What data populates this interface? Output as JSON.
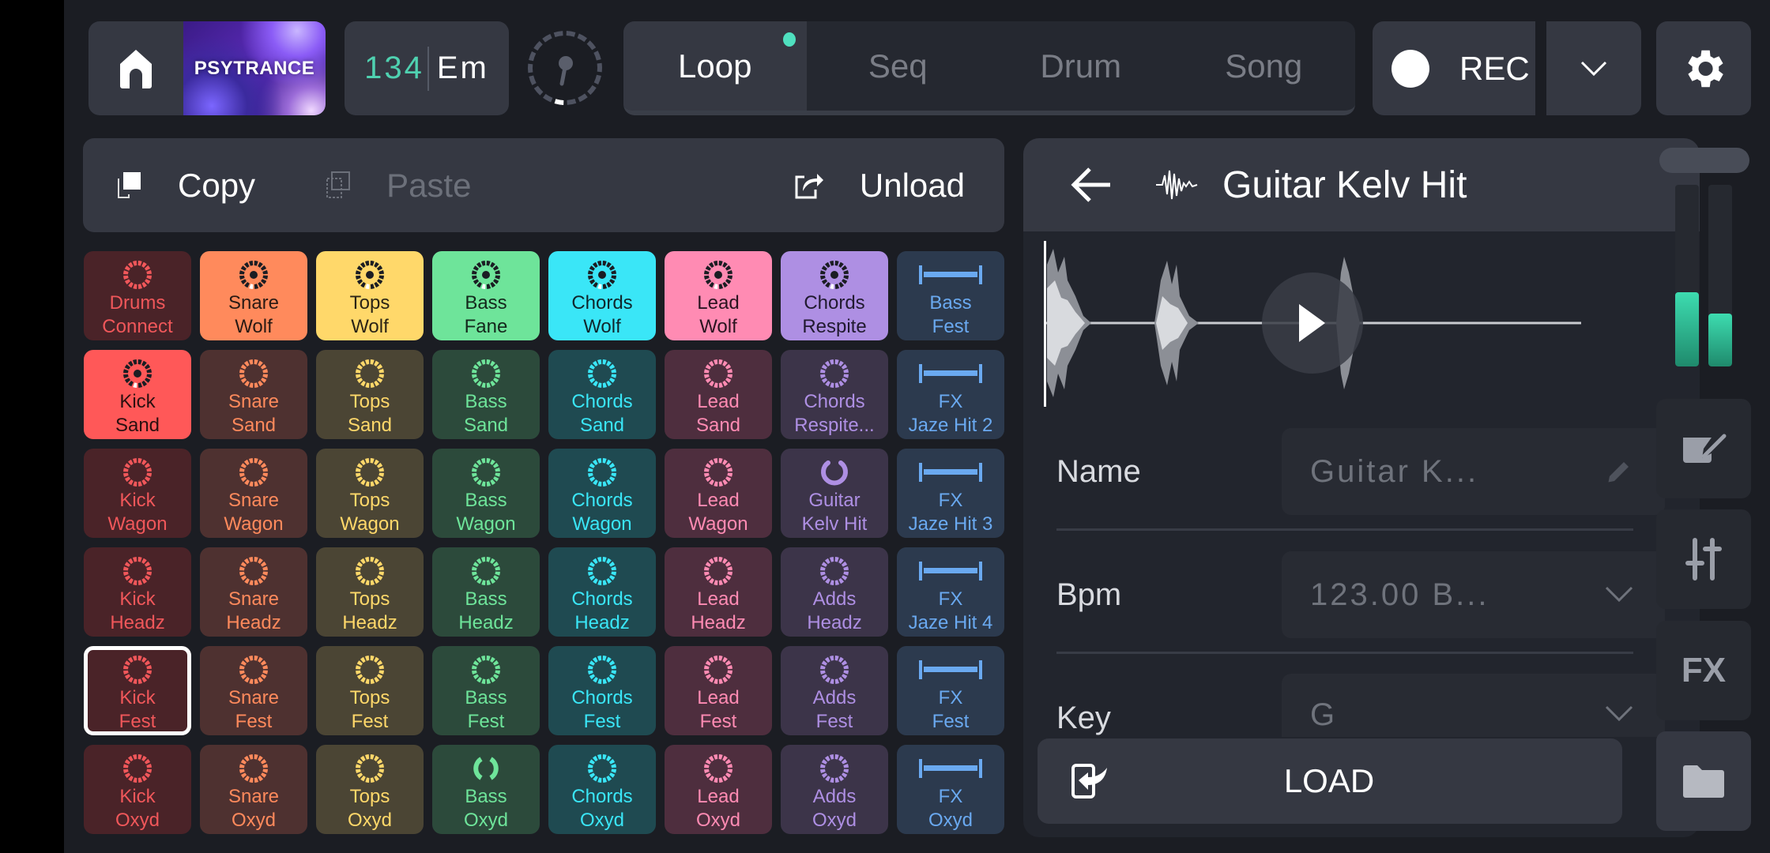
{
  "topbar": {
    "project_cover_label": "PSYTRANCE",
    "tempo": "134",
    "key": "Em",
    "tabs": [
      {
        "label": "Loop",
        "active": true,
        "indicator": true
      },
      {
        "label": "Seq",
        "active": false
      },
      {
        "label": "Drum",
        "active": false
      },
      {
        "label": "Song",
        "active": false
      }
    ],
    "rec_label": "REC",
    "icons": {
      "home": "home-icon",
      "metronome": "dial-icon",
      "dropdown": "chevron-down-icon",
      "settings": "gear-icon"
    }
  },
  "toolbar": {
    "copy_label": "Copy",
    "paste_label": "Paste",
    "unload_label": "Unload"
  },
  "pads": [
    [
      {
        "l1": "Drums",
        "l2": "Connect",
        "bg": "#4a2328",
        "fg": "#f0575a",
        "icon": "ring"
      },
      {
        "l1": "Snare",
        "l2": "Wolf",
        "bg": "#ff8a5c",
        "fg": "#2a1a14",
        "icon": "playing"
      },
      {
        "l1": "Tops",
        "l2": "Wolf",
        "bg": "#ffd86a",
        "fg": "#2a2416",
        "icon": "playing"
      },
      {
        "l1": "Bass",
        "l2": "Fane",
        "bg": "#6ee49a",
        "fg": "#14281c",
        "icon": "playing"
      },
      {
        "l1": "Chords",
        "l2": "Wolf",
        "bg": "#3ae6f7",
        "fg": "#10262c",
        "icon": "playing"
      },
      {
        "l1": "Lead",
        "l2": "Wolf",
        "bg": "#ff8bb3",
        "fg": "#2a1420",
        "icon": "playing"
      },
      {
        "l1": "Chords",
        "l2": "Respite",
        "bg": "#ae8fe3",
        "fg": "#211a30",
        "icon": "playing"
      },
      {
        "l1": "Bass",
        "l2": "Fest",
        "bg": "#2c3a4e",
        "fg": "#6aa9f0",
        "icon": "oneshot"
      }
    ],
    [
      {
        "l1": "Kick",
        "l2": "Sand",
        "bg": "#ff5858",
        "fg": "#2a1010",
        "icon": "playing"
      },
      {
        "l1": "Snare",
        "l2": "Sand",
        "bg": "#4e3130",
        "fg": "#ff8a5c",
        "icon": "ring"
      },
      {
        "l1": "Tops",
        "l2": "Sand",
        "bg": "#4b4534",
        "fg": "#ffd86a",
        "icon": "ring"
      },
      {
        "l1": "Bass",
        "l2": "Sand",
        "bg": "#2c4a3b",
        "fg": "#6ee49a",
        "icon": "ring"
      },
      {
        "l1": "Chords",
        "l2": "Sand",
        "bg": "#1f4a51",
        "fg": "#3ae6f7",
        "icon": "ring"
      },
      {
        "l1": "Lead",
        "l2": "Sand",
        "bg": "#4e2e3e",
        "fg": "#ff8bb3",
        "icon": "ring"
      },
      {
        "l1": "Chords",
        "l2": "Respite...",
        "bg": "#3c3449",
        "fg": "#ae8fe3",
        "icon": "ring"
      },
      {
        "l1": "FX",
        "l2": "Jaze Hit 2",
        "bg": "#2c3a4e",
        "fg": "#6aa9f0",
        "icon": "oneshot"
      }
    ],
    [
      {
        "l1": "Kick",
        "l2": "Wagon",
        "bg": "#4a2328",
        "fg": "#f0575a",
        "icon": "ring"
      },
      {
        "l1": "Snare",
        "l2": "Wagon",
        "bg": "#4e3130",
        "fg": "#ff8a5c",
        "icon": "ring"
      },
      {
        "l1": "Tops",
        "l2": "Wagon",
        "bg": "#4b4534",
        "fg": "#ffd86a",
        "icon": "ring"
      },
      {
        "l1": "Bass",
        "l2": "Wagon",
        "bg": "#2c4a3b",
        "fg": "#6ee49a",
        "icon": "ring"
      },
      {
        "l1": "Chords",
        "l2": "Wagon",
        "bg": "#1f4a51",
        "fg": "#3ae6f7",
        "icon": "ring"
      },
      {
        "l1": "Lead",
        "l2": "Wagon",
        "bg": "#4e2e3e",
        "fg": "#ff8bb3",
        "icon": "ring"
      },
      {
        "l1": "Guitar",
        "l2": "Kelv Hit",
        "bg": "#3c3449",
        "fg": "#ae8fe3",
        "icon": "loading"
      },
      {
        "l1": "FX",
        "l2": "Jaze Hit 3",
        "bg": "#2c3a4e",
        "fg": "#6aa9f0",
        "icon": "oneshot"
      }
    ],
    [
      {
        "l1": "Kick",
        "l2": "Headz",
        "bg": "#4a2328",
        "fg": "#f0575a",
        "icon": "ring"
      },
      {
        "l1": "Snare",
        "l2": "Headz",
        "bg": "#4e3130",
        "fg": "#ff8a5c",
        "icon": "ring"
      },
      {
        "l1": "Tops",
        "l2": "Headz",
        "bg": "#4b4534",
        "fg": "#ffd86a",
        "icon": "ring"
      },
      {
        "l1": "Bass",
        "l2": "Headz",
        "bg": "#2c4a3b",
        "fg": "#6ee49a",
        "icon": "ring"
      },
      {
        "l1": "Chords",
        "l2": "Headz",
        "bg": "#1f4a51",
        "fg": "#3ae6f7",
        "icon": "ring"
      },
      {
        "l1": "Lead",
        "l2": "Headz",
        "bg": "#4e2e3e",
        "fg": "#ff8bb3",
        "icon": "ring"
      },
      {
        "l1": "Adds",
        "l2": "Headz",
        "bg": "#3c3449",
        "fg": "#ae8fe3",
        "icon": "ring"
      },
      {
        "l1": "FX",
        "l2": "Jaze Hit 4",
        "bg": "#2c3a4e",
        "fg": "#6aa9f0",
        "icon": "oneshot"
      }
    ],
    [
      {
        "l1": "Kick",
        "l2": "Fest",
        "bg": "#4a2328",
        "fg": "#f0575a",
        "icon": "ring",
        "selected": true
      },
      {
        "l1": "Snare",
        "l2": "Fest",
        "bg": "#4e3130",
        "fg": "#ff8a5c",
        "icon": "ring"
      },
      {
        "l1": "Tops",
        "l2": "Fest",
        "bg": "#4b4534",
        "fg": "#ffd86a",
        "icon": "ring"
      },
      {
        "l1": "Bass",
        "l2": "Fest",
        "bg": "#2c4a3b",
        "fg": "#6ee49a",
        "icon": "ring"
      },
      {
        "l1": "Chords",
        "l2": "Fest",
        "bg": "#1f4a51",
        "fg": "#3ae6f7",
        "icon": "ring"
      },
      {
        "l1": "Lead",
        "l2": "Fest",
        "bg": "#4e2e3e",
        "fg": "#ff8bb3",
        "icon": "ring"
      },
      {
        "l1": "Adds",
        "l2": "Fest",
        "bg": "#3c3449",
        "fg": "#ae8fe3",
        "icon": "ring"
      },
      {
        "l1": "FX",
        "l2": "Fest",
        "bg": "#2c3a4e",
        "fg": "#6aa9f0",
        "icon": "oneshot"
      }
    ],
    [
      {
        "l1": "Kick",
        "l2": "Oxyd",
        "bg": "#4a2328",
        "fg": "#f0575a",
        "icon": "ring"
      },
      {
        "l1": "Snare",
        "l2": "Oxyd",
        "bg": "#4e3130",
        "fg": "#ff8a5c",
        "icon": "ring"
      },
      {
        "l1": "Tops",
        "l2": "Oxyd",
        "bg": "#4b4534",
        "fg": "#ffd86a",
        "icon": "ring"
      },
      {
        "l1": "Bass",
        "l2": "Oxyd",
        "bg": "#2c4a3b",
        "fg": "#6ee49a",
        "icon": "split"
      },
      {
        "l1": "Chords",
        "l2": "Oxyd",
        "bg": "#1f4a51",
        "fg": "#3ae6f7",
        "icon": "ring"
      },
      {
        "l1": "Lead",
        "l2": "Oxyd",
        "bg": "#4e2e3e",
        "fg": "#ff8bb3",
        "icon": "ring"
      },
      {
        "l1": "Adds",
        "l2": "Oxyd",
        "bg": "#3c3449",
        "fg": "#ae8fe3",
        "icon": "ring"
      },
      {
        "l1": "FX",
        "l2": "Oxyd",
        "bg": "#2c3a4e",
        "fg": "#6aa9f0",
        "icon": "oneshot"
      }
    ]
  ],
  "detail": {
    "title": "Guitar Kelv Hit",
    "fields": [
      {
        "label": "Name",
        "value": "Guitar K...",
        "control": "pencil-icon"
      },
      {
        "label": "Bpm",
        "value": "123.00 B...",
        "control": "chevron-down-icon"
      },
      {
        "label": "Key",
        "value": "G",
        "control": "chevron-down-icon"
      }
    ],
    "load_label": "LOAD"
  },
  "side": {
    "meter_levels": [
      0.41,
      0.29
    ],
    "buttons": [
      {
        "name": "edit",
        "label": ""
      },
      {
        "name": "mixer",
        "label": ""
      },
      {
        "name": "fx",
        "label": "FX"
      },
      {
        "name": "browser",
        "label": ""
      }
    ]
  },
  "colors": {
    "accent": "#4fe0bf",
    "panel": "#353842",
    "background": "#1b1d23"
  }
}
